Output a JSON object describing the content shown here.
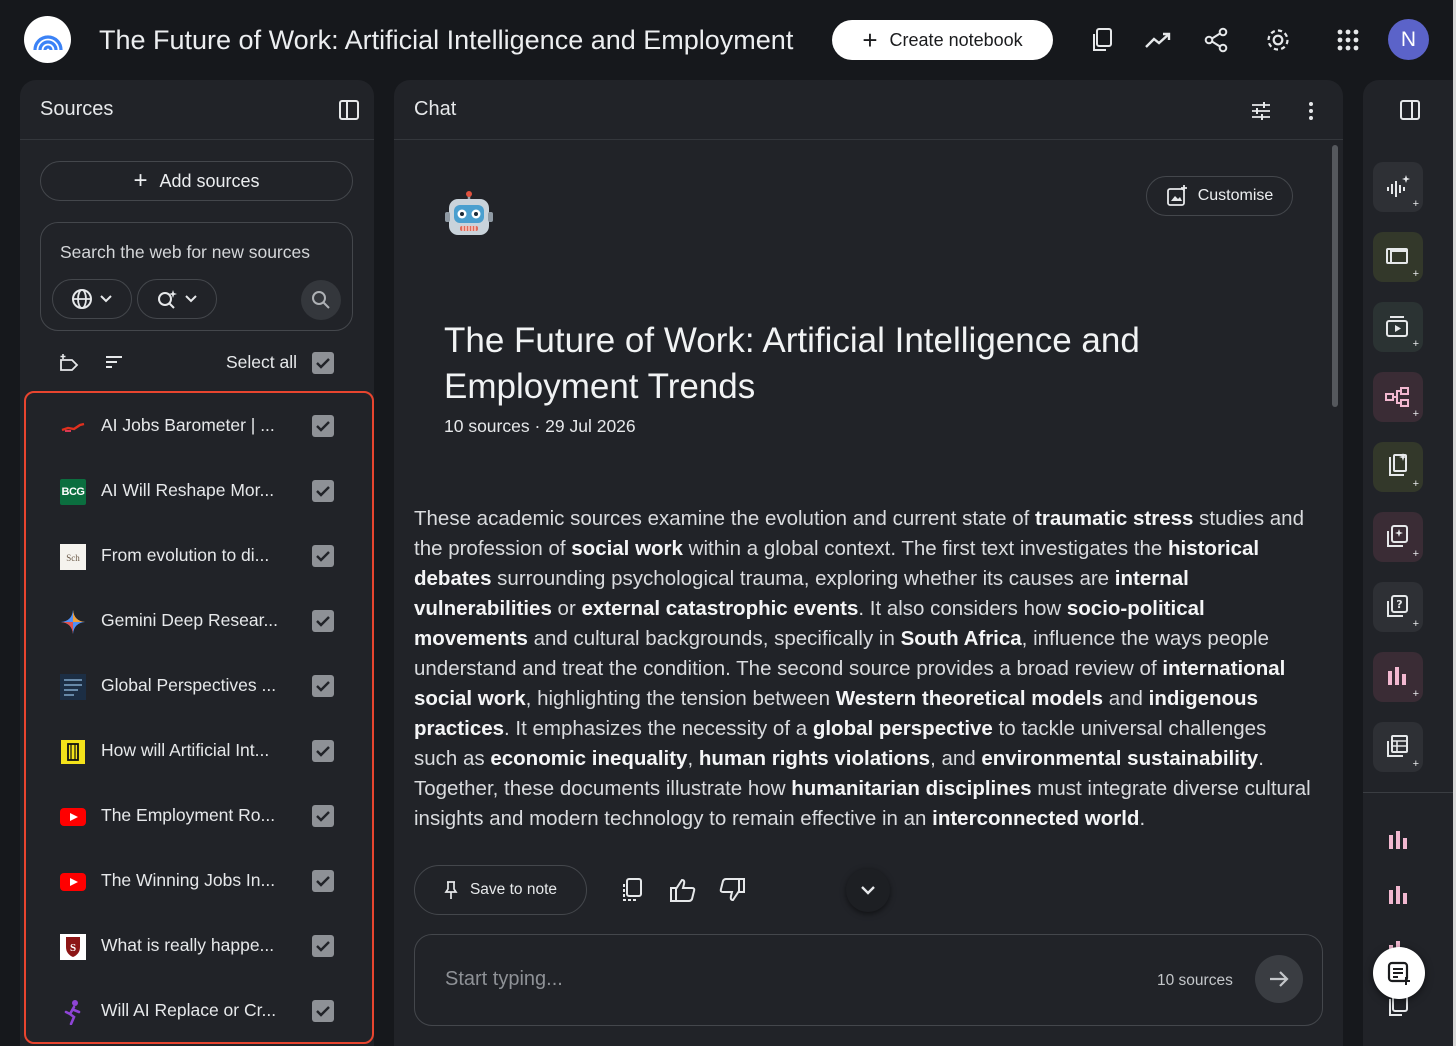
{
  "header": {
    "title": "The Future of Work: Artificial Intelligence and Employment",
    "create_label": "Create notebook",
    "avatar_initial": "N",
    "icons": [
      "copy-icon",
      "analytics-icon",
      "share-icon",
      "settings-icon",
      "apps-grid-icon"
    ]
  },
  "sources_panel": {
    "title": "Sources",
    "add_label": "Add sources",
    "search_placeholder": "Search the web for new sources",
    "select_all_label": "Select all",
    "items": [
      {
        "label": "AI Jobs Barometer | ...",
        "icon": "pwc-logo-icon",
        "checked": true
      },
      {
        "label": "AI Will Reshape Mor...",
        "icon": "bcg-logo-icon",
        "logo_text": "BCG",
        "checked": true
      },
      {
        "label": "From evolution to di...",
        "icon": "scholar-logo-icon",
        "checked": true
      },
      {
        "label": "Gemini Deep Resear...",
        "icon": "gemini-sparkle-icon",
        "checked": true
      },
      {
        "label": "Global Perspectives ...",
        "icon": "journal-logo-icon",
        "checked": true
      },
      {
        "label": "How will Artificial Int...",
        "icon": "document-logo-icon",
        "checked": true
      },
      {
        "label": "The Employment Ro...",
        "icon": "youtube-icon",
        "checked": true
      },
      {
        "label": "The Winning Jobs In...",
        "icon": "youtube-icon",
        "checked": true
      },
      {
        "label": "What is really happe...",
        "icon": "stanford-logo-icon",
        "checked": true
      },
      {
        "label": "Will AI Replace or Cr...",
        "icon": "runner-logo-icon",
        "checked": true
      }
    ]
  },
  "chat": {
    "title": "Chat",
    "customise_label": "Customise",
    "doc_title": "The Future of Work: Artificial Intelligence and Employment Trends",
    "doc_meta": "10 sources · 29 Jul 2026",
    "summary_segments": [
      {
        "t": "These academic sources examine the evolution and current state of ",
        "b": false
      },
      {
        "t": "traumatic stress",
        "b": true
      },
      {
        "t": " studies and the profession of ",
        "b": false
      },
      {
        "t": "social work",
        "b": true
      },
      {
        "t": " within a global context. The first text investigates the ",
        "b": false
      },
      {
        "t": "historical debates",
        "b": true
      },
      {
        "t": " surrounding psychological trauma, exploring whether its causes are ",
        "b": false
      },
      {
        "t": "internal vulnerabilities",
        "b": true
      },
      {
        "t": " or ",
        "b": false
      },
      {
        "t": "external catastrophic events",
        "b": true
      },
      {
        "t": ". It also considers how ",
        "b": false
      },
      {
        "t": "socio-political movements",
        "b": true
      },
      {
        "t": " and cultural backgrounds, specifically in ",
        "b": false
      },
      {
        "t": "South Africa",
        "b": true
      },
      {
        "t": ", influence the ways people understand and treat the condition. The second source provides a broad review of ",
        "b": false
      },
      {
        "t": "international social work",
        "b": true
      },
      {
        "t": ", highlighting the tension between ",
        "b": false
      },
      {
        "t": "Western theoretical models",
        "b": true
      },
      {
        "t": " and ",
        "b": false
      },
      {
        "t": "indigenous practices",
        "b": true
      },
      {
        "t": ". It emphasizes the necessity of a ",
        "b": false
      },
      {
        "t": "global perspective",
        "b": true
      },
      {
        "t": " to tackle universal challenges such as ",
        "b": false
      },
      {
        "t": "economic inequality",
        "b": true
      },
      {
        "t": ", ",
        "b": false
      },
      {
        "t": "human rights violations",
        "b": true
      },
      {
        "t": ", and ",
        "b": false
      },
      {
        "t": "environmental sustainability",
        "b": true
      },
      {
        "t": ". Together, these documents illustrate how ",
        "b": false
      },
      {
        "t": "humanitarian disciplines",
        "b": true
      },
      {
        "t": " must integrate diverse cultural insights and modern technology to remain effective in an ",
        "b": false
      },
      {
        "t": "interconnected world",
        "b": true
      },
      {
        "t": ".",
        "b": false
      }
    ],
    "save_note_label": "Save to note",
    "input_placeholder": "Start typing...",
    "input_source_count": "10 sources"
  },
  "studio": {
    "tools": [
      {
        "icon": "audio-overview-icon",
        "bg": "#2e3035"
      },
      {
        "icon": "slide-deck-icon",
        "bg": "#33382a"
      },
      {
        "icon": "video-overview-icon",
        "bg": "#2b3333"
      },
      {
        "icon": "mind-map-icon",
        "bg": "#3a2c35"
      },
      {
        "icon": "reports-icon",
        "bg": "#33382a"
      },
      {
        "icon": "flashcards-icon",
        "bg": "#3a2c35"
      },
      {
        "icon": "quiz-icon",
        "bg": "#2e3035"
      },
      {
        "icon": "infographic-icon",
        "bg": "#3a2c35"
      },
      {
        "icon": "data-table-icon",
        "bg": "#2e3035"
      }
    ],
    "colors": {
      "accent_outline": "#e8452f",
      "create_button_bg": "#ffffff",
      "avatar_bg": "#5b63c9"
    }
  }
}
